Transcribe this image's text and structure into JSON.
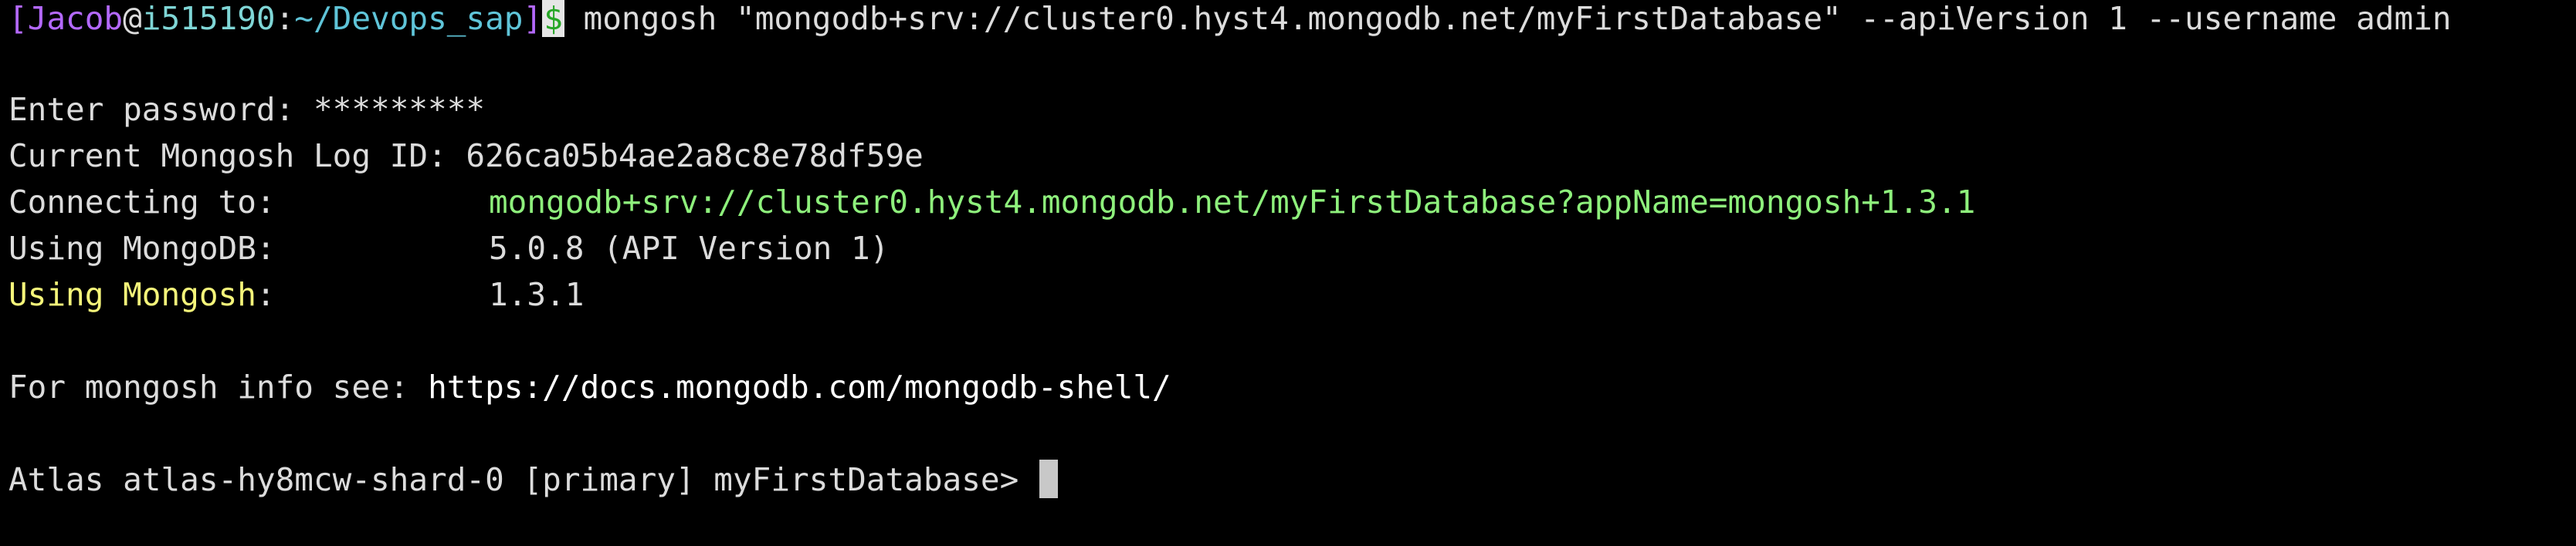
{
  "command_line": {
    "open_bracket": "[",
    "user": "Jacob",
    "at": "@",
    "host": "i515190",
    "colon": ":",
    "path": "~/Devops_sap",
    "close_bracket": "]",
    "dollar": "$",
    "command": " mongosh \"mongodb+srv://cluster0.hyst4.mongodb.net/myFirstDatabase\" --apiVersion 1 --username admin"
  },
  "output": {
    "password_label": "Enter password: ",
    "password_mask": "*********",
    "log_id_label": "Current Mongosh Log ID: ",
    "log_id": "626ca05b4ae2a8c8e78df59e",
    "connecting_label": "Connecting to:",
    "connecting_url": "mongodb+srv://cluster0.hyst4.mongodb.net/myFirstDatabase?appName=mongosh+1.3.1",
    "mongodb_label": "Using MongoDB:",
    "mongodb_version": "5.0.8 (API Version 1)",
    "mongosh_label": "Using Mongosh",
    "mongosh_label_colon": ":",
    "mongosh_version": "1.3.1",
    "info_label": "For mongosh info see: ",
    "info_url": "https://docs.mongodb.com/mongodb-shell/",
    "shell_prompt": "Atlas atlas-hy8mcw-shard-0 [primary] myFirstDatabase> "
  },
  "colors": {
    "background": "#000000",
    "text": "#dcdcdc",
    "prompt_user": "#b469ff",
    "prompt_path": "#5fc4d8",
    "url_green": "#8ef07c",
    "highlight_yellow": "#f5f57a"
  }
}
